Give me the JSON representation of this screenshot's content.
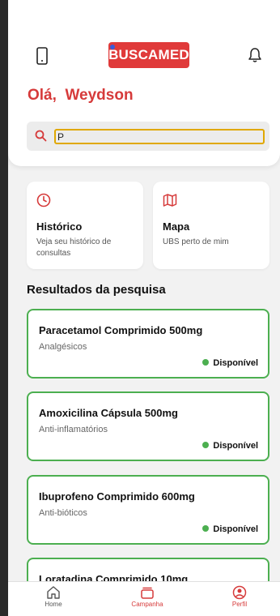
{
  "header": {
    "logo_text": "BUSCAMED",
    "greeting": "Olá,  Weydson"
  },
  "search": {
    "value": "P",
    "placeholder": ""
  },
  "tiles": [
    {
      "title": "Histórico",
      "description": "Veja seu histórico de consultas",
      "icon": "clock-icon"
    },
    {
      "title": "Mapa",
      "description": "UBS perto de mim",
      "icon": "map-icon"
    }
  ],
  "results": {
    "title": "Resultados da pesquisa",
    "items": [
      {
        "name": "Paracetamol Comprimido 500mg",
        "category": "Analgésicos",
        "status": "Disponível"
      },
      {
        "name": "Amoxicilina Cápsula 500mg",
        "category": "Anti-inflamatórios",
        "status": "Disponível"
      },
      {
        "name": "Ibuprofeno Comprimido 600mg",
        "category": "Anti-bióticos",
        "status": "Disponível"
      },
      {
        "name": "Loratadina Comprimido 10mg",
        "category": "",
        "status": ""
      }
    ]
  },
  "nav": {
    "items": [
      {
        "label": "Home",
        "icon": "home-icon",
        "active": false
      },
      {
        "label": "Campanha",
        "icon": "campaign-icon",
        "active": true
      },
      {
        "label": "Perfil",
        "icon": "profile-icon",
        "active": true
      }
    ]
  },
  "colors": {
    "brand": "#e03a3a",
    "available": "#4caf50",
    "search_focus": "#e0a800"
  }
}
